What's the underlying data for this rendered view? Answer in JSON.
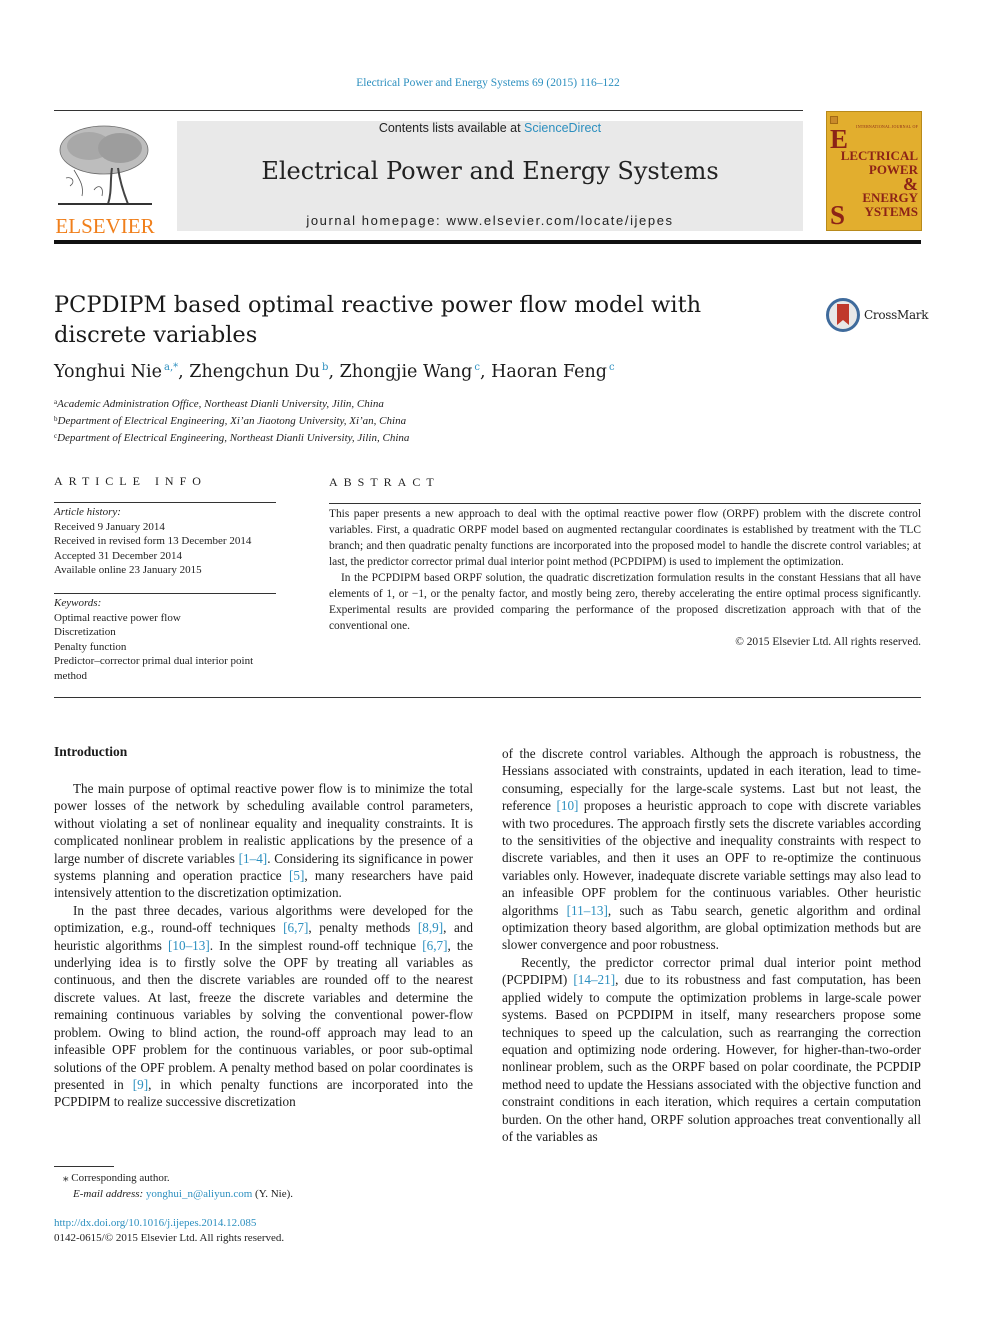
{
  "journal_ref": "Electrical Power and Energy Systems 69 (2015) 116–122",
  "header": {
    "contents_prefix": "Contents lists available at ",
    "contents_link": "ScienceDirect",
    "journal_title": "Electrical Power and Energy Systems",
    "homepage": "journal homepage: www.elsevier.com/locate/ijepes",
    "publisher": "ELSEVIER",
    "cover": {
      "intl": "INTERNATIONAL JOURNAL OF",
      "line1_big": "E",
      "line1": "LECTRICAL",
      "line2": "POWER",
      "line3": "&",
      "line4": "ENERGY",
      "line5_big": "S",
      "line5": "YSTEMS"
    },
    "colors": {
      "link": "#2c8fbf",
      "elsevier_orange": "#f07f1b",
      "cover_bg": "#e2ae2e",
      "header_bg": "#e9e9e9"
    }
  },
  "article": {
    "title": "PCPDIPM based optimal reactive power flow model with discrete variables",
    "crossmark_label": "CrossMark",
    "authors": [
      {
        "name": "Yonghui Nie",
        "sup": "a,*"
      },
      {
        "name": "Zhengchun Du",
        "sup": "b"
      },
      {
        "name": "Zhongjie Wang",
        "sup": "c"
      },
      {
        "name": "Haoran Feng",
        "sup": "c"
      }
    ],
    "affiliations": [
      {
        "sup": "a",
        "text": "Academic Administration Office, Northeast Dianli University, Jilin, China"
      },
      {
        "sup": "b",
        "text": "Department of Electrical Engineering, Xi’an Jiaotong University, Xi’an, China"
      },
      {
        "sup": "c",
        "text": "Department of Electrical Engineering, Northeast Dianli University, Jilin, China"
      }
    ]
  },
  "article_info": {
    "heading": "ARTICLE INFO",
    "history_label": "Article history:",
    "history": [
      "Received 9 January 2014",
      "Received in revised form 13 December 2014",
      "Accepted 31 December 2014",
      "Available online 23 January 2015"
    ],
    "keywords_label": "Keywords:",
    "keywords": [
      "Optimal reactive power flow",
      "Discretization",
      "Penalty function",
      "Predictor–corrector primal dual interior point method"
    ]
  },
  "abstract": {
    "heading": "ABSTRACT",
    "p1": "This paper presents a new approach to deal with the optimal reactive power flow (ORPF) problem with the discrete control variables. First, a quadratic ORPF model based on augmented rectangular coordinates is established by treatment with the TLC branch; and then quadratic penalty functions are incorporated into the proposed model to handle the discrete control variables; at last, the predictor corrector primal dual interior point method (PCPDIPM) is used to implement the optimization.",
    "p2": "In the PCPDIPM based ORPF solution, the quadratic discretization formulation results in the constant Hessians that all have elements of 1, or −1, or the penalty factor, and mostly being zero, thereby accelerating the entire optimal process significantly. Experimental results are provided comparing the performance of the proposed discretization approach with that of the conventional one.",
    "copyright": "© 2015 Elsevier Ltd. All rights reserved."
  },
  "body": {
    "intro_heading": "Introduction",
    "left": {
      "p1": [
        "The main purpose of optimal reactive power flow is to minimize the total power losses of the network by scheduling available control parameters, without violating a set of nonlinear equality and inequality constraints. It is complicated nonlinear problem in realistic applications by the presence of a large number of discrete variables ",
        "[1–4]",
        ". Considering its significance in power systems planning and operation practice ",
        "[5]",
        ", many researchers have paid intensively attention to the discretization optimization."
      ],
      "p2": [
        "In the past three decades, various algorithms were developed for the optimization, e.g., round-off techniques ",
        "[6,7]",
        ", penalty methods ",
        "[8,9]",
        ", and heuristic algorithms ",
        "[10–13]",
        ". In the simplest round-off technique ",
        "[6,7]",
        ", the underlying idea is to firstly solve the OPF by treating all variables as continuous, and then the discrete variables are rounded off to the nearest discrete values. At last, freeze the discrete variables and determine the remaining continuous variables by solving the conventional power-flow problem. Owing to blind action, the round-off approach may lead to an infeasible OPF problem for the continuous variables, or poor sub-optimal solutions of the OPF problem. A penalty method based on polar coordinates is presented in ",
        "[9]",
        ", in which penalty functions are incorporated into the PCPDIPM to realize successive discretization"
      ]
    },
    "right": {
      "p1": [
        "of the discrete control variables. Although the approach is robustness, the Hessians associated with constraints, updated in each iteration, lead to time-consuming, especially for the large-scale systems. Last but not least, the reference ",
        "[10]",
        " proposes a heuristic approach to cope with discrete variables with two procedures. The approach firstly sets the discrete variables according to the sensitivities of the objective and inequality constraints with respect to discrete variables, and then it uses an OPF to re-optimize the continuous variables only. However, inadequate discrete variable settings may also lead to an infeasible OPF problem for the continuous variables. Other heuristic algorithms ",
        "[11–13]",
        ", such as Tabu search, genetic algorithm and ordinal optimization theory based algorithm, are global optimization methods but are slower convergence and poor robustness."
      ],
      "p2": [
        "Recently, the predictor corrector primal dual interior point method (PCPDIPM) ",
        "[14–21]",
        ", due to its robustness and fast computation, has been applied widely to compute the optimization problems in large-scale power systems. Based on PCPDIPM in itself, many researchers propose some techniques to speed up the calculation, such as rearranging the correction equation and optimizing node ordering. However, for higher-than-two-order nonlinear problem, such as the ORPF based on polar coordinate, the PCPDIP method need to update the Hessians associated with the objective function and constraint conditions in each iteration, which requires a certain computation burden. On the other hand, ORPF solution approaches treat conventionally all of the variables as"
      ]
    }
  },
  "footnotes": {
    "star": "⁎",
    "corresponding": "Corresponding author.",
    "email_label": "E-mail address: ",
    "email": "yonghui_n@aliyun.com",
    "email_suffix": " (Y. Nie).",
    "doi": "http://dx.doi.org/10.1016/j.ijepes.2014.12.085",
    "issn_line": "0142-0615/© 2015 Elsevier Ltd. All rights reserved."
  }
}
